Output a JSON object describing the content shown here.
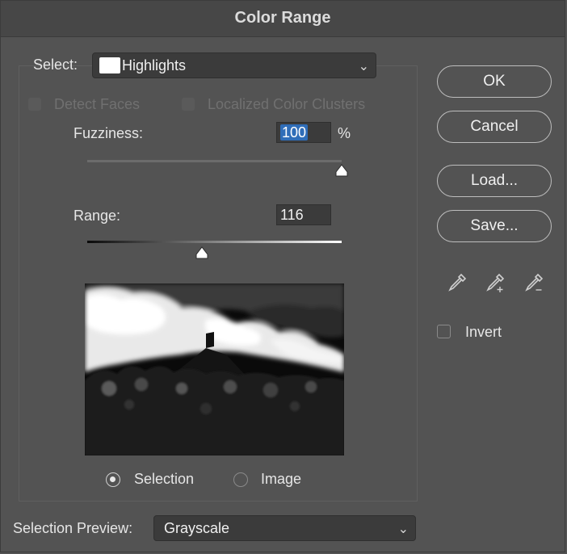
{
  "dialog": {
    "title": "Color Range"
  },
  "select": {
    "label": "Select:",
    "value": "Highlights",
    "swatch_color": "#ffffff"
  },
  "options": {
    "detect_faces": "Detect Faces",
    "localized_clusters": "Localized Color Clusters"
  },
  "fuzziness": {
    "label": "Fuzziness:",
    "value": "100",
    "unit": "%",
    "slider_fraction": 1.0
  },
  "range": {
    "label": "Range:",
    "value": "116",
    "slider_fraction": 0.45
  },
  "preview_mode": {
    "selection": "Selection",
    "image": "Image",
    "selected": "Selection"
  },
  "selection_preview": {
    "label": "Selection Preview:",
    "value": "Grayscale"
  },
  "buttons": {
    "ok": "OK",
    "cancel": "Cancel",
    "load": "Load...",
    "save": "Save..."
  },
  "tools": [
    "eyedropper-icon",
    "eyedropper-plus-icon",
    "eyedropper-minus-icon"
  ],
  "invert": {
    "label": "Invert",
    "checked": false
  },
  "colors": {
    "dialog_bg": "#535353",
    "field_bg": "#3b3b3b",
    "highlight": "#2f6db8"
  }
}
